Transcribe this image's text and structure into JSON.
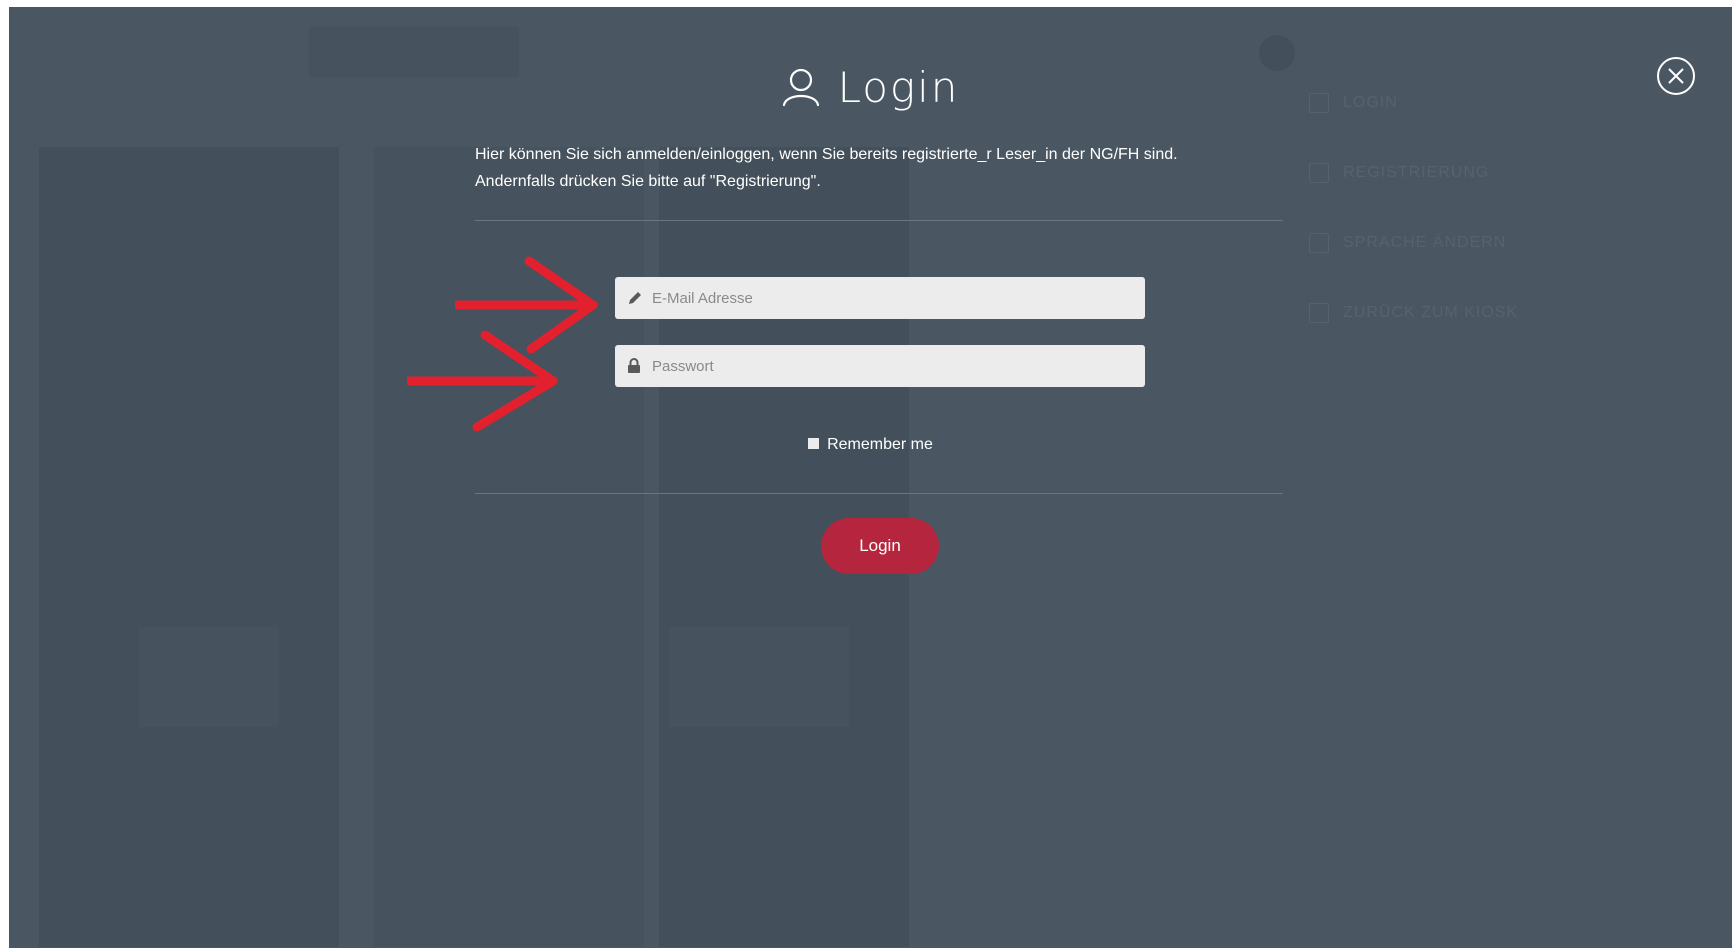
{
  "modal": {
    "title": "Login",
    "intro_line1": "Hier können Sie sich anmelden/einloggen, wenn Sie bereits registrierte_r Leser_in der NG/FH sind.",
    "intro_line2": "Andernfalls drücken Sie bitte auf \"Registrierung\".",
    "email_placeholder": "E-Mail Adresse",
    "email_value": "",
    "password_placeholder": "Passwort",
    "password_value": "",
    "remember_label": "Remember me",
    "remember_checked": false,
    "login_button": "Login",
    "close_icon": "close-circle-icon",
    "title_icon": "user-icon"
  },
  "background_menu": {
    "items": [
      "LOGIN",
      "REGISTRIERUNG",
      "SPRACHE ÄNDERN",
      "ZURÜCK ZUM KIOSK"
    ]
  },
  "annotations": {
    "arrow_color": "#e2202e"
  },
  "colors": {
    "overlay": "#4a5661",
    "accent": "#b5253d",
    "field_bg": "#ececec"
  }
}
